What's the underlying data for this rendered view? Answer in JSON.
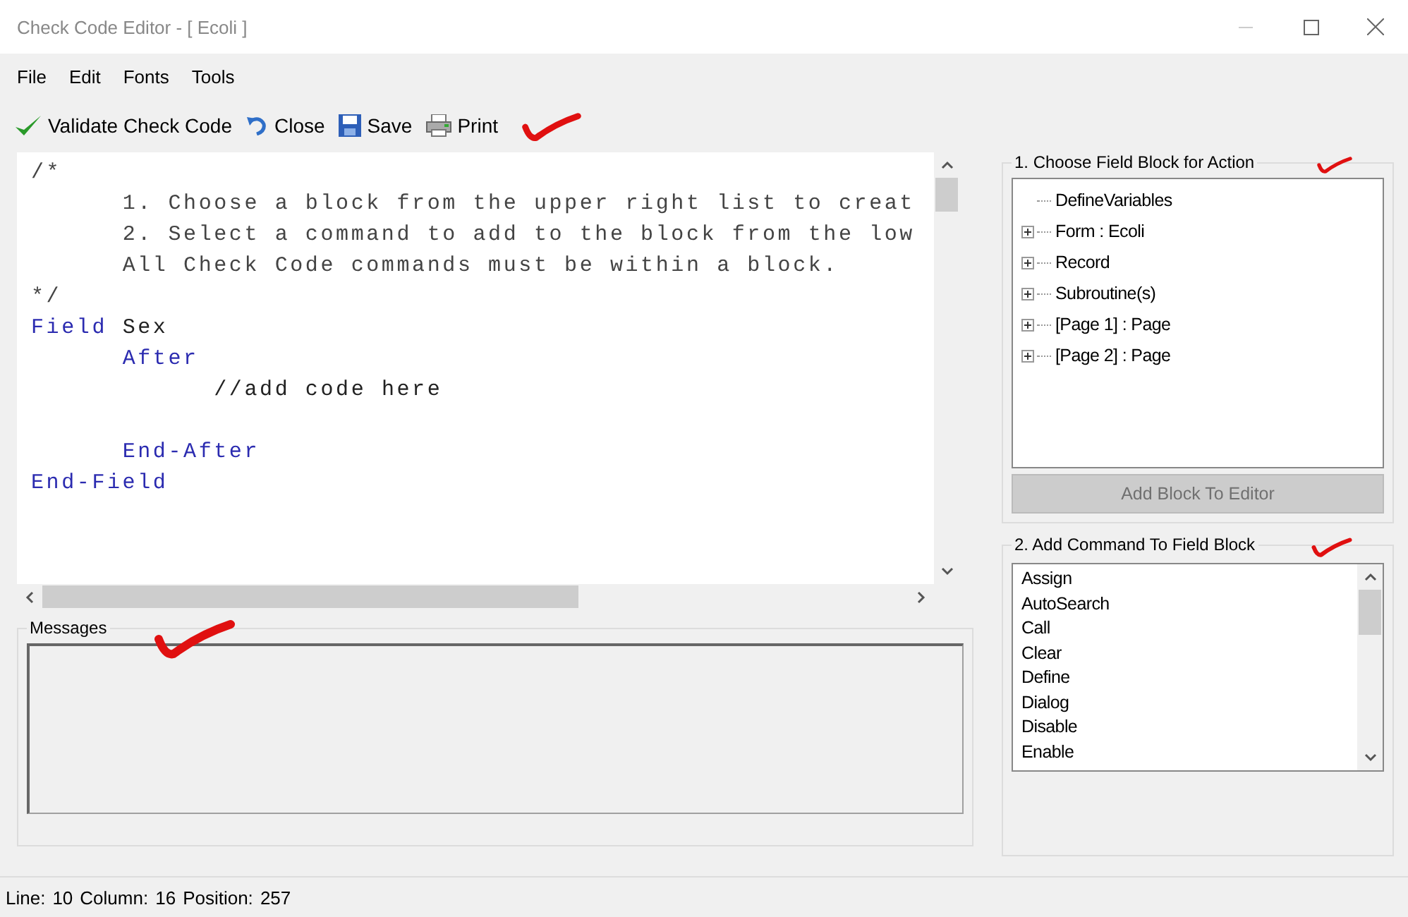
{
  "window": {
    "title": "Check Code Editor - [ Ecoli ]"
  },
  "menu": [
    "File",
    "Edit",
    "Fonts",
    "Tools"
  ],
  "toolbar": [
    {
      "kind": "validate",
      "label": "Validate Check Code"
    },
    {
      "kind": "close",
      "label": "Close"
    },
    {
      "kind": "save",
      "label": "Save"
    },
    {
      "kind": "print",
      "label": "Print"
    }
  ],
  "editor": {
    "lines": [
      {
        "kind": "code",
        "tokens": [
          {
            "kind": "comment",
            "text": "/*"
          }
        ]
      },
      {
        "kind": "code",
        "tokens": [
          {
            "kind": "comment",
            "text": "\t1. Choose a block from the upper right list to creat"
          }
        ]
      },
      {
        "kind": "code",
        "tokens": [
          {
            "kind": "comment",
            "text": "\t2. Select a command to add to the block from the low"
          }
        ]
      },
      {
        "kind": "code",
        "tokens": [
          {
            "kind": "comment",
            "text": "\tAll Check Code commands must be within a block."
          }
        ]
      },
      {
        "kind": "code",
        "tokens": [
          {
            "kind": "comment",
            "text": "*/"
          }
        ]
      },
      {
        "kind": "code",
        "tokens": [
          {
            "kind": "keyword",
            "text": "Field"
          },
          {
            "kind": "plain",
            "text": " Sex"
          }
        ]
      },
      {
        "kind": "code",
        "tokens": [
          {
            "kind": "keyword",
            "text": "\tAfter"
          }
        ]
      },
      {
        "kind": "code",
        "tokens": [
          {
            "kind": "plain",
            "text": "\t\t//add code here"
          }
        ]
      },
      {
        "kind": "blank"
      },
      {
        "kind": "code",
        "tokens": [
          {
            "kind": "keyword",
            "text": "\tEnd-After"
          }
        ]
      },
      {
        "kind": "code",
        "tokens": [
          {
            "kind": "keyword",
            "text": "End-Field"
          }
        ]
      }
    ]
  },
  "messages": {
    "title": "Messages"
  },
  "field_block": {
    "title": "1. Choose Field Block for Action",
    "tree": [
      {
        "label": "DefineVariables",
        "expandable": false
      },
      {
        "label": "Form : Ecoli",
        "expandable": true,
        "expanded": false
      },
      {
        "label": "Record",
        "expandable": true,
        "expanded": false
      },
      {
        "label": "Subroutine(s)",
        "expandable": true,
        "expanded": false
      },
      {
        "label": "[Page 1] : Page",
        "expandable": true,
        "expanded": false
      },
      {
        "label": "[Page 2] : Page",
        "expandable": true,
        "expanded": false
      }
    ],
    "button": {
      "label": "Add Block To Editor",
      "disabled": true
    }
  },
  "commands": {
    "title": "2. Add Command To Field Block",
    "items": [
      {
        "label": "Assign",
        "selected": false
      },
      {
        "label": "AutoSearch",
        "selected": false
      },
      {
        "label": "Call",
        "selected": false
      },
      {
        "label": "Clear",
        "selected": false
      },
      {
        "label": "Define",
        "selected": false
      },
      {
        "label": "Dialog",
        "selected": false
      },
      {
        "label": "Disable",
        "selected": false
      },
      {
        "label": "Enable",
        "selected": false
      }
    ]
  },
  "status_bar": [
    "Line:",
    "10",
    "Column:",
    "16",
    "Position:",
    "257"
  ]
}
